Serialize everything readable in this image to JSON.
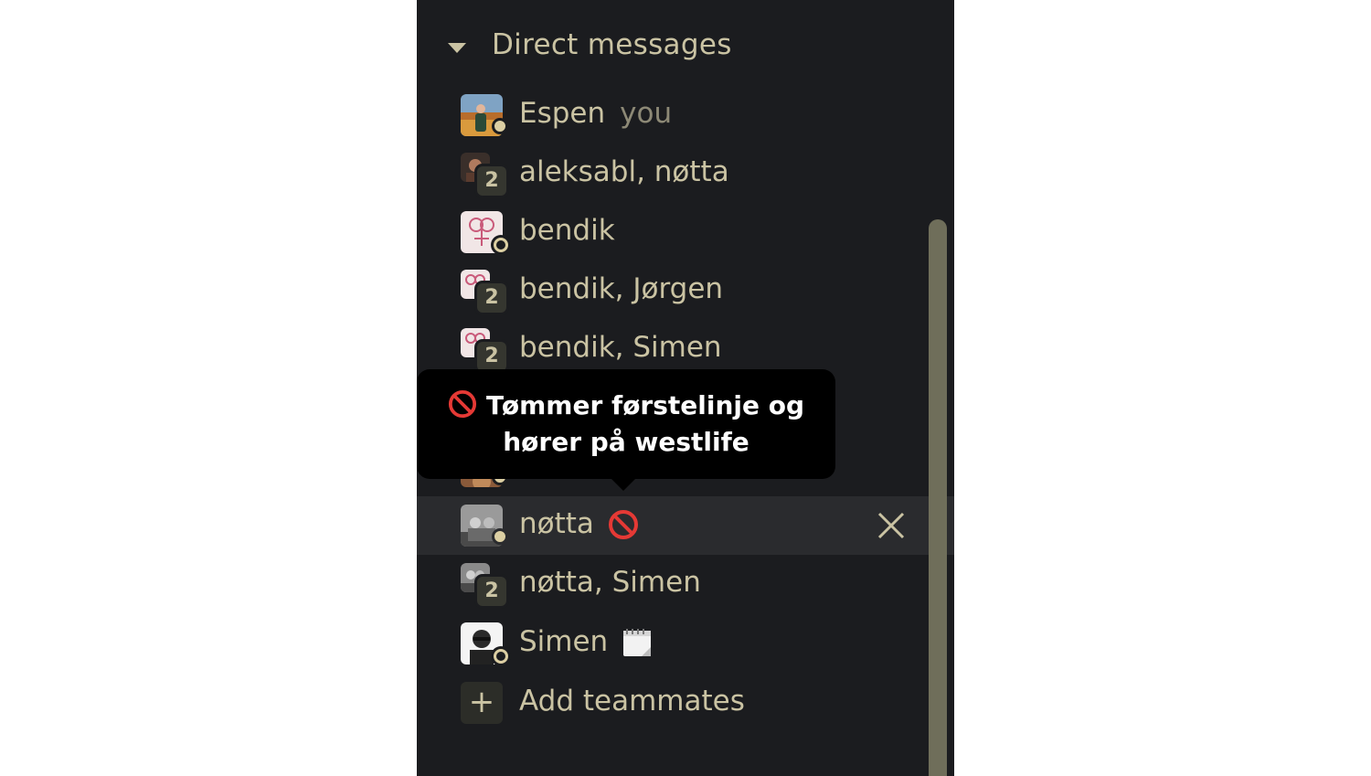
{
  "section": {
    "title": "Direct messages"
  },
  "rows": [
    {
      "label": "Espen",
      "suffix": "you",
      "status": "online"
    },
    {
      "label": "aleksabl, nøtta",
      "count": "2"
    },
    {
      "label": "bendik",
      "status": "away"
    },
    {
      "label": "bendik, Jørgen",
      "count": "2"
    },
    {
      "label": "bendik, Simen",
      "count": "2"
    },
    {
      "label": "nøtta",
      "status": "online",
      "emoji": "no-entry-icon"
    },
    {
      "label": "nøtta, Simen",
      "count": "2"
    },
    {
      "label": "Simen",
      "status": "away",
      "emoji": "notepad-icon"
    }
  ],
  "add_teammates": {
    "label": "Add teammates"
  },
  "tooltip": {
    "line1": "Tømmer førstelinje og",
    "line2": "hører på westlife",
    "emoji": "no-entry-icon"
  },
  "colors": {
    "sidebar_bg": "#1b1c1f",
    "text": "#cac3a3",
    "active_row": "#2a2b2e",
    "scrollbar": "#6f6e5a"
  }
}
